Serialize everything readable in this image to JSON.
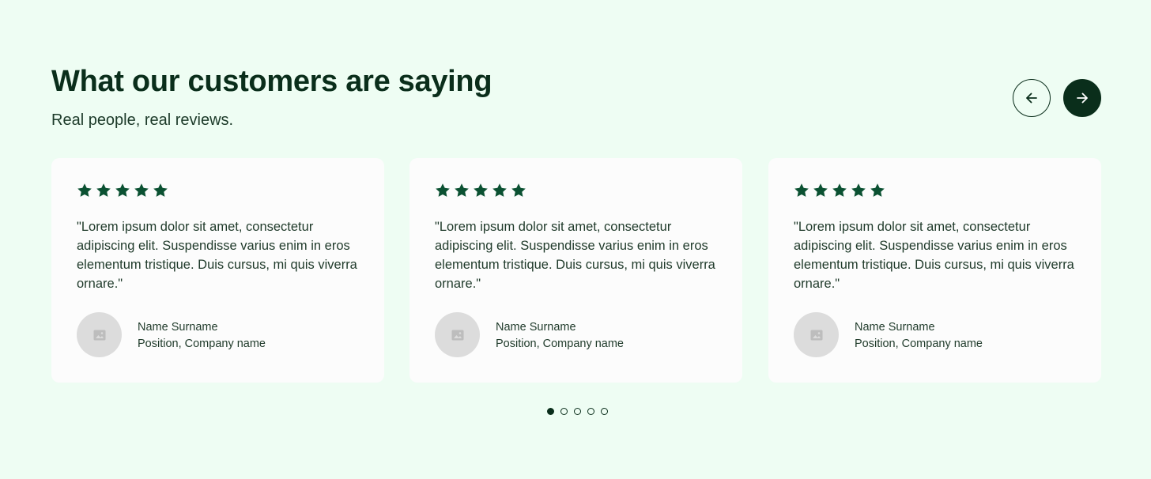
{
  "header": {
    "title": "What our customers are saying",
    "subtitle": "Real people, real reviews."
  },
  "navigation": {
    "prev_icon": "arrow-left-icon",
    "next_icon": "arrow-right-icon"
  },
  "colors": {
    "background": "#eefdf3",
    "primary": "#0a2e1b",
    "star": "#0b5132",
    "card": "#fcfcfc",
    "avatar_placeholder": "#dcdcdc"
  },
  "testimonials": [
    {
      "rating": 5,
      "quote": "\"Lorem ipsum dolor sit amet, consectetur adipiscing elit. Suspendisse varius enim in eros elementum tristique. Duis cursus, mi quis viverra ornare.\"",
      "name": "Name Surname",
      "position": "Position, Company name",
      "avatar_icon": "image-placeholder-icon"
    },
    {
      "rating": 5,
      "quote": "\"Lorem ipsum dolor sit amet, consectetur adipiscing elit. Suspendisse varius enim in eros elementum tristique. Duis cursus, mi quis viverra ornare.\"",
      "name": "Name Surname",
      "position": "Position, Company name",
      "avatar_icon": "image-placeholder-icon"
    },
    {
      "rating": 5,
      "quote": "\"Lorem ipsum dolor sit amet, consectetur adipiscing elit. Suspendisse varius enim in eros elementum tristique. Duis cursus, mi quis viverra ornare.\"",
      "name": "Name Surname",
      "position": "Position, Company name",
      "avatar_icon": "image-placeholder-icon"
    }
  ],
  "pagination": {
    "total": 5,
    "active_index": 0
  }
}
